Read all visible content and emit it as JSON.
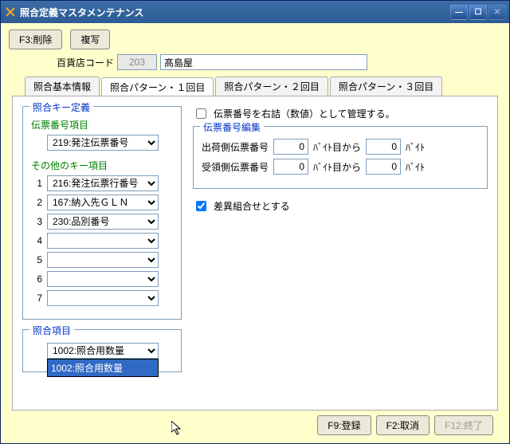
{
  "window": {
    "title": "照合定義マスタメンテナンス"
  },
  "toolbar": {
    "delete": "F3:削除",
    "copy": "複写"
  },
  "code": {
    "label": "百貨店コード",
    "value": "203",
    "name": "髙島屋"
  },
  "tabs": {
    "t1": "照合基本情報",
    "t2": "照合パターン・１回目",
    "t3": "照合パターン・２回目",
    "t4": "照合パターン・３回目"
  },
  "keydef": {
    "legend": "照合キー定義",
    "slip_label": "伝票番号項目",
    "slip_value": "219:発注伝票番号",
    "other_label": "その他のキー項目",
    "rows": {
      "n1": "1",
      "v1": "216:発注伝票行番号",
      "n2": "2",
      "v2": "167:納入先ＧＬＮ",
      "n3": "3",
      "v3": "230:品別番号",
      "n4": "4",
      "v4": "",
      "n5": "5",
      "v5": "",
      "n6": "6",
      "v6": "",
      "n7": "7",
      "v7": ""
    }
  },
  "match": {
    "legend": "照合項目",
    "value": "1002:照合用数量",
    "option": "1002:照合用数量"
  },
  "right": {
    "chk_rightjust": "伝票番号を右詰（数値）として管理する。",
    "editbox": {
      "legend": "伝票番号編集",
      "ship_label": "出荷側伝票番号",
      "ship_from": "0",
      "unit_from": "ﾊﾞｲﾄ目から",
      "ship_len": "0",
      "unit_len": "ﾊﾞｲﾄ",
      "recv_label": "受領側伝票番号",
      "recv_from": "0",
      "recv_len": "0"
    },
    "chk_diff": "差異組合せとする"
  },
  "footer": {
    "register": "F9:登録",
    "cancel": "F2:取消",
    "exit": "F12:終了"
  }
}
